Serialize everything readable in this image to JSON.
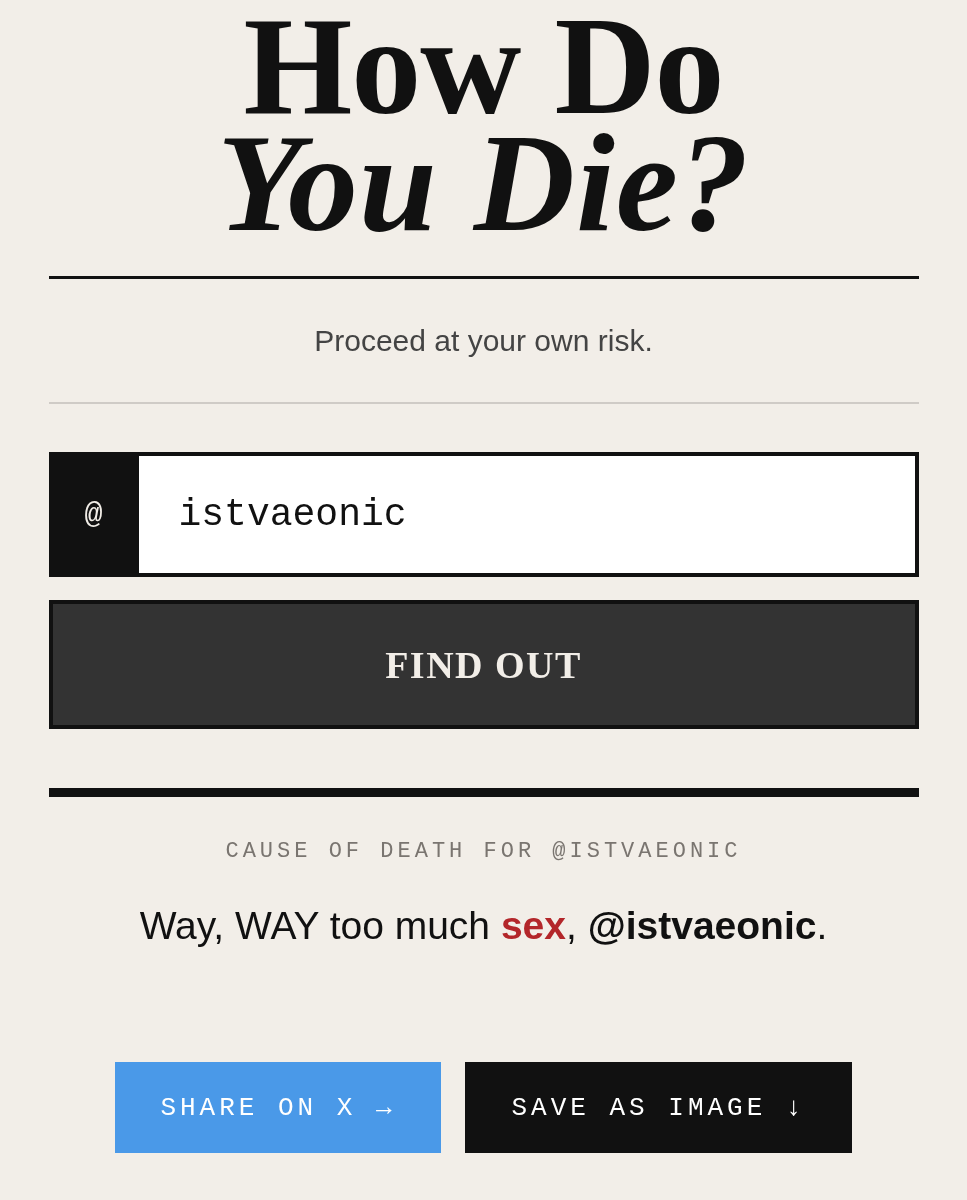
{
  "title": {
    "lines": [
      {
        "text": "How Do",
        "kind": "upright"
      },
      {
        "text": "You Die?",
        "kind": "italic"
      }
    ]
  },
  "tagline": "Proceed at your own risk.",
  "handle_field": {
    "prefix": "@",
    "value": "istvaeonic"
  },
  "submit_button": "FIND OUT",
  "result": {
    "caption": "CAUSE OF DEATH FOR @ISTVAEONIC",
    "sentence": [
      {
        "text": "Way, WAY too much ",
        "kind": "plain"
      },
      {
        "text": "sex",
        "kind": "cause"
      },
      {
        "text": ", ",
        "kind": "plain"
      },
      {
        "text": "@istvaeonic",
        "kind": "handle"
      },
      {
        "text": ".",
        "kind": "plain"
      }
    ]
  },
  "actions": [
    {
      "label": "SHARE ON X →",
      "kind": "share"
    },
    {
      "label": "SAVE AS IMAGE ↓",
      "kind": "save"
    }
  ]
}
